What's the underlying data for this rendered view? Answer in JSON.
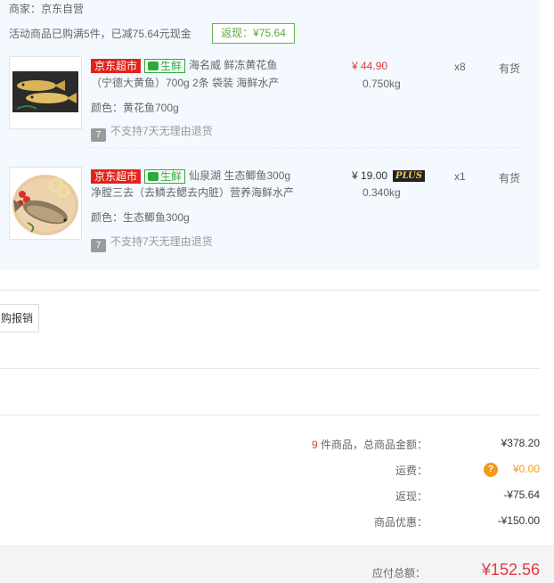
{
  "order": {
    "merchant": "商家：京东自营",
    "promo": "活动商品已购满5件，已减75.64元现金",
    "cashback_badge": "返现：¥75.64"
  },
  "items": [
    {
      "tag_jd": "京东超市",
      "tag_fresh": "生鲜",
      "title_1": "海名威 鲜冻黄花鱼",
      "title_2": "（宁德大黄鱼）700g 2条 袋装 海鲜水产",
      "spec": "颜色：黄花鱼700g",
      "no_return": "不支持7天无理由退货",
      "no_return_icon": "7",
      "price": "¥ 44.90",
      "weight": "0.750kg",
      "qty": "x8",
      "stock": "有货"
    },
    {
      "tag_jd": "京东超市",
      "tag_fresh": "生鲜",
      "title_1": "仙泉湖 生态鲫鱼300g",
      "title_2": "净膛三去（去鳞去鳃去内脏）营养海鲜水产",
      "spec": "颜色：生态鲫鱼300g",
      "no_return": "不支持7天无理由退货",
      "no_return_icon": "7",
      "price": "¥ 19.00",
      "plus_badge": "PLUS",
      "weight": "0.340kg",
      "qty": "x1",
      "stock": "有货"
    }
  ],
  "invoice_button": "购报销",
  "summary": {
    "count": "9",
    "count_label": "件商品，总商品金额：",
    "goods_total": "¥378.20",
    "freight_label": "运费：",
    "freight_help": "?",
    "freight_value": "¥0.00",
    "cashback_label": "返现：",
    "cashback_value": "-¥75.64",
    "discount_label": "商品优惠：",
    "discount_value": "-¥150.00"
  },
  "total": {
    "label": "应付总额：",
    "value": "¥152.56"
  },
  "colors": {
    "accent_red": "#e4393c",
    "fresh_green": "#2cab3a",
    "cashback_green": "#5ea83a",
    "freight_orange": "#f39a18",
    "panel_blue": "#f3f9fe"
  }
}
